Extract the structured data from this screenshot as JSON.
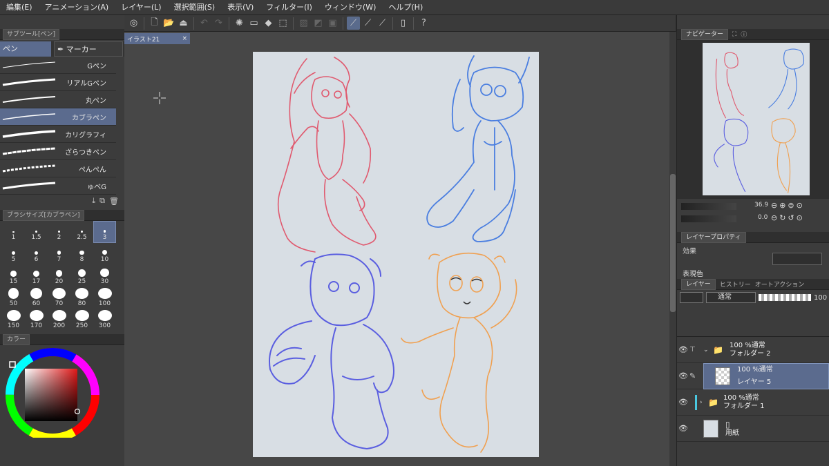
{
  "menu": [
    "編集(E)",
    "アニメーション(A)",
    "レイヤー(L)",
    "選択範囲(S)",
    "表示(V)",
    "フィルター(I)",
    "ウィンドウ(W)",
    "ヘルプ(H)"
  ],
  "subtool": {
    "tab_label": "サブツール[ペン]",
    "groups": [
      "ペン",
      "マーカー"
    ],
    "brushes": [
      {
        "name": "Gペン",
        "selected": false
      },
      {
        "name": "リアルGペン",
        "selected": false
      },
      {
        "name": "丸ペン",
        "selected": false
      },
      {
        "name": "カブラペン",
        "selected": true
      },
      {
        "name": "カリグラフィ",
        "selected": false
      },
      {
        "name": "ざらつきペン",
        "selected": false
      },
      {
        "name": "ぺんぺん",
        "selected": false
      },
      {
        "name": "ゅべG",
        "selected": false
      }
    ]
  },
  "brush_size": {
    "tab_label": "ブラシサイズ[カブラペン]",
    "sizes": [
      "1",
      "1.5",
      "2",
      "2.5",
      "3",
      "5",
      "6",
      "7",
      "8",
      "10",
      "15",
      "17",
      "20",
      "25",
      "30",
      "50",
      "60",
      "70",
      "80",
      "100",
      "150",
      "170",
      "200",
      "250",
      "300"
    ],
    "selected": "3"
  },
  "color_tab": "カラー",
  "colors": {
    "accent": "#5b6b8e",
    "paper": "#d8dee4",
    "red_sketch": "#e05a6f",
    "blue_sketch": "#4a7ee0",
    "indigo_sketch": "#5a5ee0",
    "orange_sketch": "#f0a050"
  },
  "document": {
    "tab_title": "イラスト21",
    "close": "×"
  },
  "navigator": {
    "tab_label": "ナビゲーター",
    "zoom": "36.9",
    "rotation": "0.0"
  },
  "layer_property": {
    "tab_label": "レイヤープロパティ",
    "effect_label": "効果",
    "expression_label": "表現色"
  },
  "layers_panel": {
    "tabs": [
      "レイヤー",
      "ヒストリー",
      "オートアクション"
    ],
    "blend_mode": "通常",
    "opacity": "100",
    "layers": [
      {
        "line1": "100 %通常",
        "line2": "フォルダー 2",
        "type": "folder",
        "selected": false
      },
      {
        "line1": "100 %通常",
        "line2": "レイヤー 5",
        "type": "raster",
        "selected": true
      },
      {
        "line1": "100 %通常",
        "line2": "フォルダー 1",
        "type": "folder",
        "selected": false
      },
      {
        "line1": "",
        "line2": "用紙",
        "type": "paper",
        "selected": false
      }
    ]
  }
}
